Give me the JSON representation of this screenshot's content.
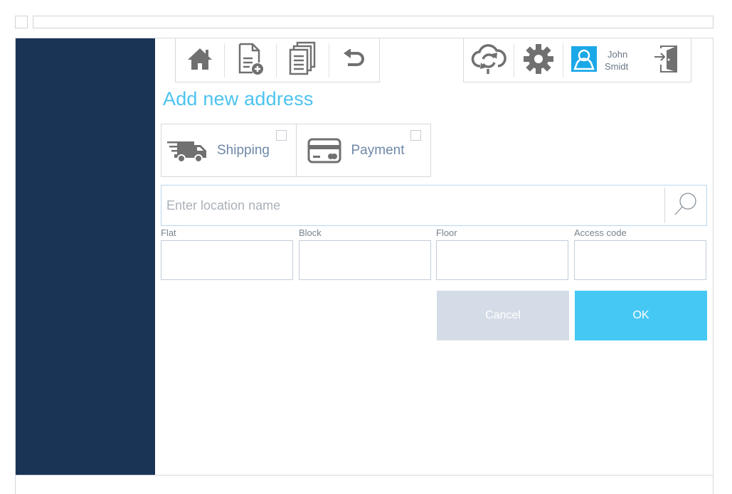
{
  "header": {
    "user": {
      "first_name": "John",
      "last_name": "Smidt"
    }
  },
  "page": {
    "title": "Add new address"
  },
  "address_types": [
    {
      "label": "Shipping",
      "checked": false
    },
    {
      "label": "Payment",
      "checked": false
    }
  ],
  "search": {
    "placeholder": "Enter location name",
    "value": ""
  },
  "fields": {
    "flat": {
      "label": "Flat",
      "value": ""
    },
    "block": {
      "label": "Block",
      "value": ""
    },
    "floor": {
      "label": "Floor",
      "value": ""
    },
    "access_code": {
      "label": "Access code",
      "value": ""
    }
  },
  "actions": {
    "cancel_label": "Cancel",
    "ok_label": "OK"
  },
  "icons": [
    "home-icon",
    "new-document-icon",
    "documents-icon",
    "undo-icon",
    "cloud-sync-icon",
    "gear-icon",
    "user-icon",
    "logout-icon",
    "truck-icon",
    "credit-card-icon",
    "search-icon"
  ],
  "colors": {
    "sidebar": "#1a3456",
    "accent": "#4cc3ef",
    "ok_button": "#46c8f5",
    "cancel_button": "#d4dde7",
    "icon_gray": "#707070",
    "user_icon": "#1ba8e8"
  }
}
